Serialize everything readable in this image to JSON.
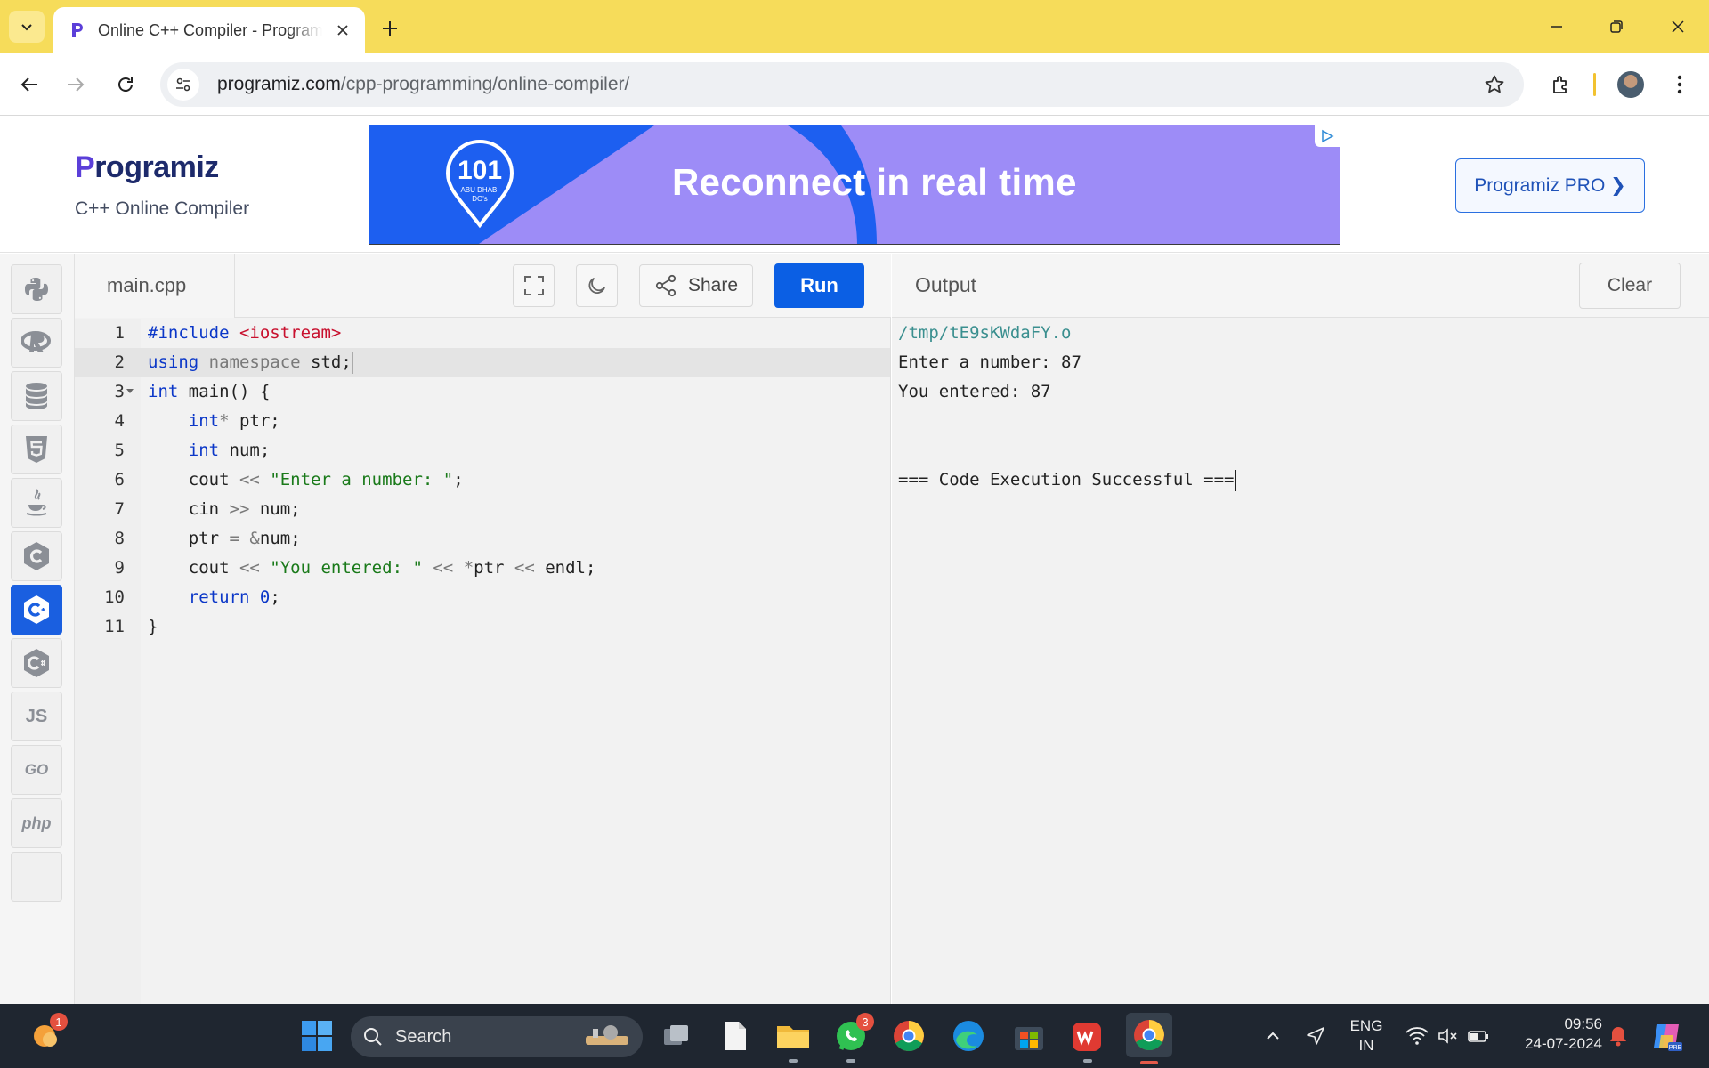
{
  "browser": {
    "tab_title": "Online C++ Compiler - Programiz",
    "url_host": "programiz.com",
    "url_path": "/cpp-programming/online-compiler/"
  },
  "site": {
    "logo_text": "rogramiz",
    "logo_initial": "P",
    "subtitle": "C++ Online Compiler",
    "pro_button": "Programiz PRO ❯",
    "ad": {
      "headline": "Reconnect in real time",
      "badge_number": "101",
      "badge_line1": "ABU DHABI",
      "badge_line2": "DO's"
    }
  },
  "languages": [
    "python",
    "r",
    "sql",
    "html",
    "java",
    "c",
    "cpp",
    "csharp",
    "javascript",
    "go",
    "php"
  ],
  "lang_labels": {
    "javascript": "JS",
    "go": "GO",
    "php": "php"
  },
  "editor": {
    "file_name": "main.cpp",
    "share_label": "Share",
    "run_label": "Run",
    "lines": [
      "1",
      "2",
      "3",
      "4",
      "5",
      "6",
      "7",
      "8",
      "9",
      "10",
      "11"
    ]
  },
  "output": {
    "title": "Output",
    "clear_label": "Clear",
    "lines": [
      "/tmp/tE9sKWdaFY.o",
      "Enter a number: 87",
      "You entered: 87",
      "",
      "",
      "=== Code Execution Successful ==="
    ]
  },
  "taskbar": {
    "search_label": "Search",
    "weather_badge": "1",
    "whatsapp_badge": "3",
    "lang_line1": "ENG",
    "lang_line2": "IN",
    "time": "09:56",
    "date": "24-07-2024"
  },
  "colors": {
    "accent": "#0b5fe4",
    "tabbar": "#f6dc5a",
    "ad_bg": "#9d8cf7"
  }
}
